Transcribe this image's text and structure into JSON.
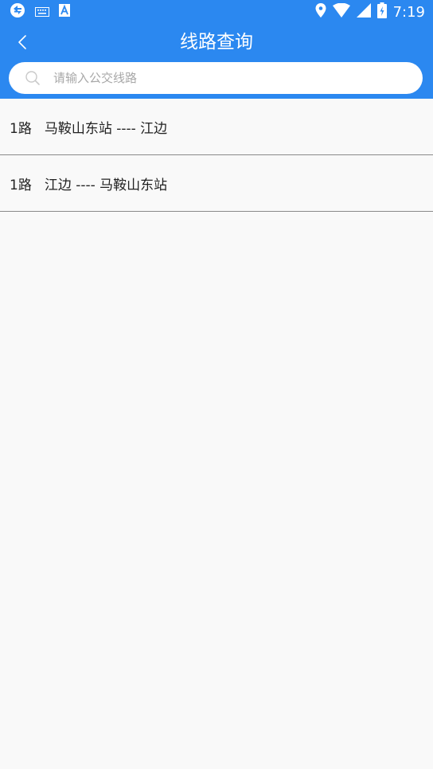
{
  "status_bar": {
    "time": "7:19",
    "icons_left": [
      "sync-icon",
      "keyboard-icon",
      "a-notification-icon"
    ],
    "icons_right": [
      "location-icon",
      "wifi-icon",
      "signal-icon",
      "battery-charging-icon"
    ]
  },
  "header": {
    "title": "线路查询",
    "back_icon": "chevron-left-icon",
    "background_color": "#2b88f0"
  },
  "search": {
    "placeholder": "请输入公交线路",
    "value": "",
    "icon": "search-icon"
  },
  "routes": [
    {
      "number": "1路",
      "direction": "马鞍山东站 ---- 江边"
    },
    {
      "number": "1路",
      "direction": "江边 ---- 马鞍山东站"
    }
  ]
}
